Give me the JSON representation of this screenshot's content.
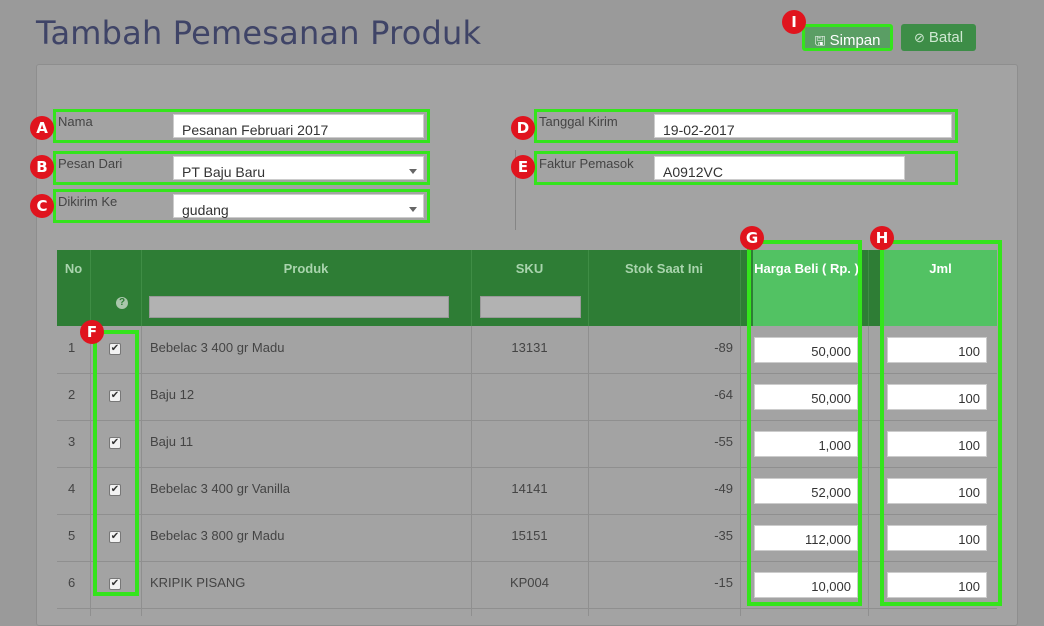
{
  "page": {
    "title": "Tambah Pemesanan Produk"
  },
  "toolbar": {
    "save_label": "Simpan",
    "save_icon": "floppy-icon",
    "cancel_label": "Batal",
    "cancel_icon": "ban-icon"
  },
  "form": {
    "nama": {
      "label": "Nama",
      "value": "Pesanan Februari 2017"
    },
    "pesan_dari": {
      "label": "Pesan Dari",
      "value": "PT Baju Baru"
    },
    "dikirim_ke": {
      "label": "Dikirim Ke",
      "value": "gudang"
    },
    "tanggal_kirim": {
      "label": "Tanggal Kirim",
      "value": "19-02-2017"
    },
    "faktur_pemasok": {
      "label": "Faktur Pemasok",
      "value": "A0912VC"
    }
  },
  "table": {
    "headers": {
      "no": "No",
      "produk": "Produk",
      "sku": "SKU",
      "stok": "Stok Saat Ini",
      "harga": "Harga Beli ( Rp. )",
      "jml": "Jml"
    },
    "help_glyph": "?",
    "rows": [
      {
        "no": "1",
        "produk": "Bebelac 3 400 gr Madu",
        "sku": "13131",
        "stok": "-89",
        "harga": "50,000",
        "jml": "100"
      },
      {
        "no": "2",
        "produk": "Baju 12",
        "sku": "",
        "stok": "-64",
        "harga": "50,000",
        "jml": "100"
      },
      {
        "no": "3",
        "produk": "Baju 11",
        "sku": "",
        "stok": "-55",
        "harga": "1,000",
        "jml": "100"
      },
      {
        "no": "4",
        "produk": "Bebelac 3 400 gr Vanilla",
        "sku": "14141",
        "stok": "-49",
        "harga": "52,000",
        "jml": "100"
      },
      {
        "no": "5",
        "produk": "Bebelac 3 800 gr Madu",
        "sku": "15151",
        "stok": "-35",
        "harga": "112,000",
        "jml": "100"
      },
      {
        "no": "6",
        "produk": "KRIPIK PISANG",
        "sku": "KP004",
        "stok": "-15",
        "harga": "10,000",
        "jml": "100"
      }
    ]
  },
  "annotations": [
    "A",
    "B",
    "C",
    "D",
    "E",
    "F",
    "G",
    "H",
    "I"
  ],
  "colors": {
    "highlight": "#34e41c",
    "badge": "#e0141e",
    "header_green": "#2e7d35",
    "title": "#3f4467"
  }
}
